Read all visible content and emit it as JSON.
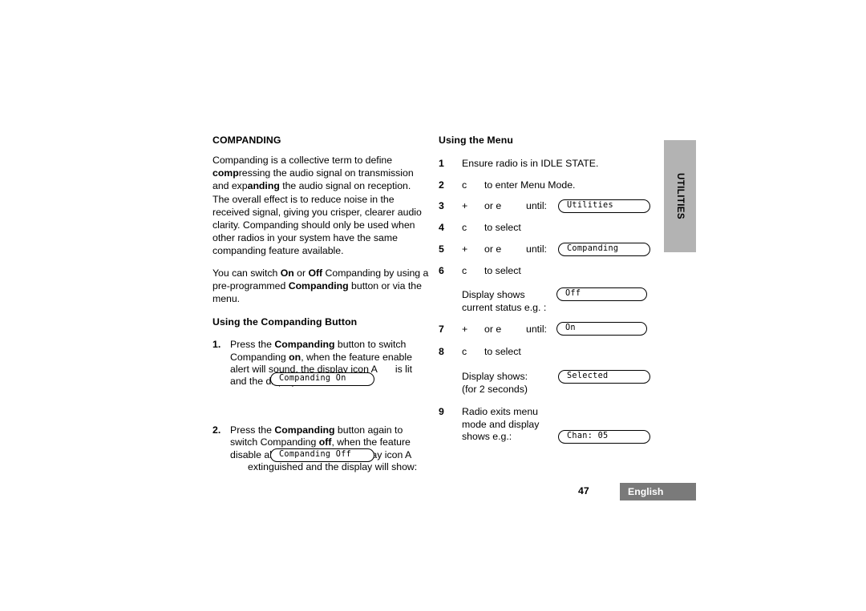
{
  "document": {
    "page_number": "47",
    "language_tag": "English",
    "side_tab": "UTILITIES",
    "colors": {
      "side_tab_bg": "#b3b3b3",
      "footer_band_bg": "#7a7a7a",
      "footer_text": "#ffffff",
      "text": "#000000",
      "page_bg": "#ffffff"
    }
  },
  "left_column": {
    "heading": "COMPANDING",
    "paragraph_1": {
      "part_1": "Companding is a collective term to define ",
      "bold_1": "comp",
      "part_2": "ressing the audio signal on transmission and exp",
      "bold_2": "anding",
      "part_3": " the audio signal on reception. The overall effect is to reduce noise in the received signal, giving you crisper, clearer audio clarity. Companding should only be used when other radios in your system have the same companding feature available."
    },
    "paragraph_2": {
      "part_1": "You can switch ",
      "bold_1": "On",
      "part_2": " or ",
      "bold_2": "Off",
      "part_3": " Companding by using a pre-programmed ",
      "bold_3": "Companding",
      "part_4": " button or via the menu."
    },
    "sub_heading": "Using the Companding Button",
    "steps": [
      {
        "number": "1.",
        "text_1": "Press the ",
        "bold_1": "Companding",
        "text_2": " button to switch Companding ",
        "bold_2": "on",
        "text_3": ", when the feature enable alert will sound, the display icon A",
        "text_4": "is lit and the display will show:",
        "display": "Companding On"
      },
      {
        "number": "2.",
        "text_1": "Press the ",
        "bold_1": "Companding",
        "text_2": " button again to switch Companding ",
        "bold_2": "off",
        "text_3": ", when the feature disable alert will sound, the display icon A",
        "text_4": "extinguished and the display will show:",
        "display": "Companding Off"
      }
    ]
  },
  "right_column": {
    "heading": "Using the Menu",
    "steps": [
      {
        "number": "1",
        "text": "Ensure radio is in IDLE STATE."
      },
      {
        "number": "2",
        "key": "c",
        "text": "to enter Menu Mode."
      },
      {
        "number": "3",
        "key": "+",
        "or": "or e",
        "until": "until:",
        "display": "Utilities"
      },
      {
        "number": "4",
        "key": "c",
        "text": "to select"
      },
      {
        "number": "5",
        "key": "+",
        "or": "or e",
        "until": "until:",
        "display": "Companding"
      },
      {
        "number": "6",
        "key": "c",
        "text": "to select"
      },
      {
        "number": "",
        "text_line_1": "Display shows",
        "text_line_2": "current status e.g. :",
        "display": "Off"
      },
      {
        "number": "7",
        "key": "+",
        "or": "or e",
        "until": "until:",
        "display": "On"
      },
      {
        "number": "8",
        "key": "c",
        "text": "to select"
      },
      {
        "number": "",
        "text_line_1": "Display shows:",
        "text_line_2": "(for 2 seconds)",
        "display": "Selected"
      },
      {
        "number": "9",
        "text_line_1": "Radio exits menu",
        "text_line_2": "mode and display",
        "text_line_3": "shows e.g.:",
        "display": "Chan: 05"
      }
    ]
  }
}
